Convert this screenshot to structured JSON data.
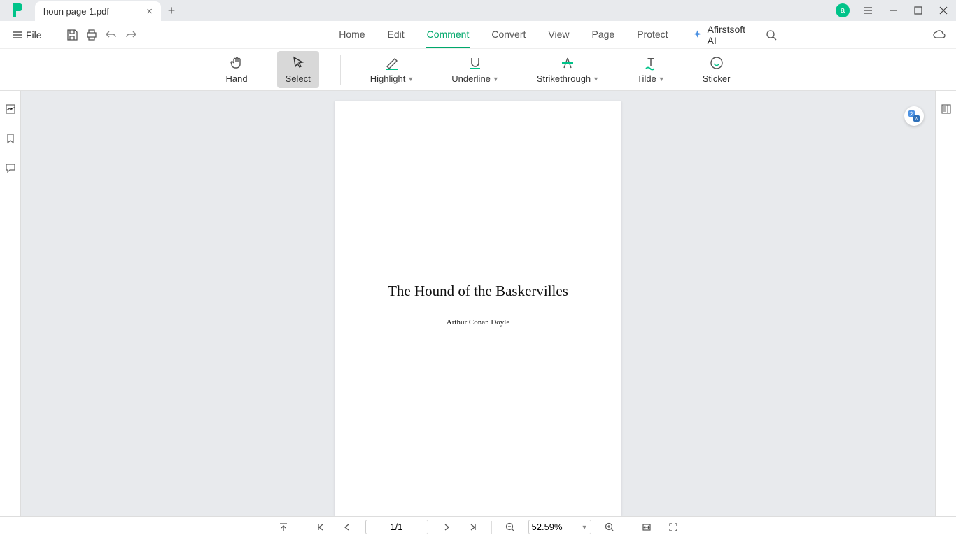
{
  "titlebar": {
    "tab_name": "houn page 1.pdf",
    "avatar_letter": "a"
  },
  "menubar": {
    "file_label": "File",
    "tabs": [
      "Home",
      "Edit",
      "Comment",
      "Convert",
      "View",
      "Page",
      "Protect"
    ],
    "active_tab_index": 2,
    "ai_label": "Afirstsoft AI"
  },
  "ribbon": {
    "hand": "Hand",
    "select": "Select",
    "highlight": "Highlight",
    "underline": "Underline",
    "strikethrough": "Strikethrough",
    "tilde": "Tilde",
    "sticker": "Sticker"
  },
  "document": {
    "title": "The Hound of the Baskervilles",
    "author": "Arthur Conan Doyle"
  },
  "statusbar": {
    "page_display": "1/1",
    "zoom_display": "52.59%"
  }
}
